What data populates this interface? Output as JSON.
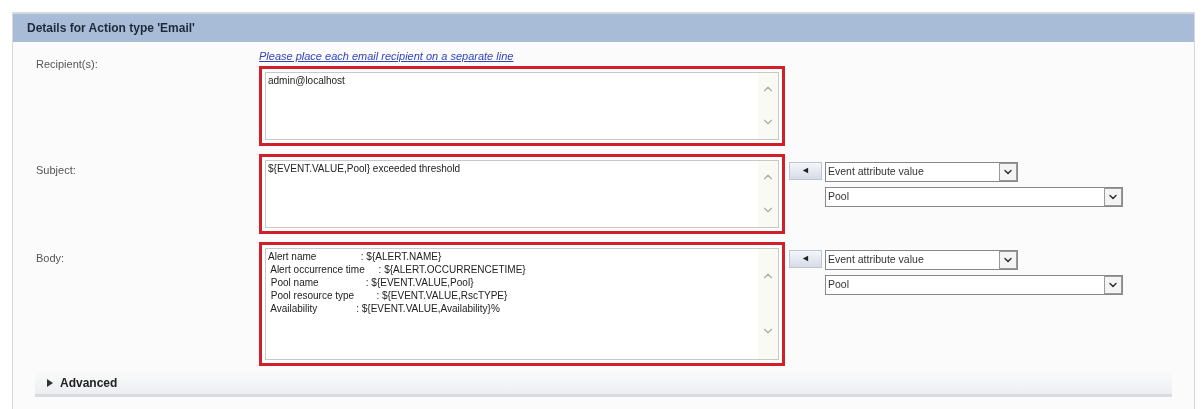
{
  "panel": {
    "title": "Details for Action type 'Email'"
  },
  "fields": [
    {
      "label": "Recipient(s):",
      "hint": "Please place each email recipient on a separate line",
      "value": "admin@localhost",
      "highlighted": true
    },
    {
      "label": "Subject:",
      "value": "${EVENT.VALUE,Pool} exceeded threshold",
      "highlighted": true,
      "insert": {
        "button": "◄",
        "type": "Event attribute value",
        "attribute": "Pool"
      }
    },
    {
      "label": "Body:",
      "value": "Alert name                : ${ALERT.NAME}\n Alert occurrence time     : ${ALERT.OCCURRENCETIME}\n Pool name                 : ${EVENT.VALUE,Pool}\n Pool resource type        : ${EVENT.VALUE,RscTYPE}\n Availability              : ${EVENT.VALUE,Availability}%",
      "highlighted": true,
      "tall": true,
      "insert": {
        "button": "◄",
        "type": "Event attribute value",
        "attribute": "Pool"
      }
    }
  ],
  "advanced": {
    "label": "Advanced",
    "expanded": false
  }
}
